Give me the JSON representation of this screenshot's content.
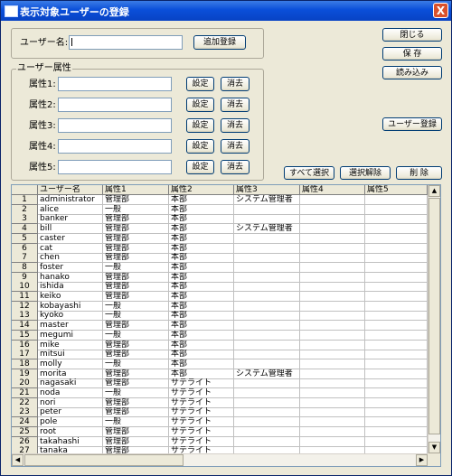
{
  "window": {
    "title": "表示対象ユーザーの登録",
    "close_label": "X"
  },
  "user_name": {
    "label": "ユーザー名:",
    "value": "",
    "add_button": "追加登録"
  },
  "attributes": {
    "group_label": "ユーザー属性",
    "items": [
      {
        "label": "属性1:",
        "value": "",
        "set": "設定",
        "clear": "消去"
      },
      {
        "label": "属性2:",
        "value": "",
        "set": "設定",
        "clear": "消去"
      },
      {
        "label": "属性3:",
        "value": "",
        "set": "設定",
        "clear": "消去"
      },
      {
        "label": "属性4:",
        "value": "",
        "set": "設定",
        "clear": "消去"
      },
      {
        "label": "属性5:",
        "value": "",
        "set": "設定",
        "clear": "消去"
      }
    ]
  },
  "side_buttons": {
    "close": "閉じる",
    "save": "保 存",
    "load": "読み込み",
    "register": "ユーザー登録"
  },
  "action_buttons": {
    "select_all": "すべて選択",
    "deselect": "選択解除",
    "delete": "削 除"
  },
  "table": {
    "columns": [
      "ユーザー名",
      "属性1",
      "属性2",
      "属性3",
      "属性4",
      "属性5"
    ],
    "rows": [
      [
        "1",
        "administrator",
        "管理部",
        "本部",
        "システム管理者",
        "",
        ""
      ],
      [
        "2",
        "alice",
        "一般",
        "本部",
        "",
        "",
        ""
      ],
      [
        "3",
        "banker",
        "管理部",
        "本部",
        "",
        "",
        ""
      ],
      [
        "4",
        "bill",
        "管理部",
        "本部",
        "システム管理者",
        "",
        ""
      ],
      [
        "5",
        "caster",
        "管理部",
        "本部",
        "",
        "",
        ""
      ],
      [
        "6",
        "cat",
        "管理部",
        "本部",
        "",
        "",
        ""
      ],
      [
        "7",
        "chen",
        "管理部",
        "本部",
        "",
        "",
        ""
      ],
      [
        "8",
        "foster",
        "一般",
        "本部",
        "",
        "",
        ""
      ],
      [
        "9",
        "hanako",
        "管理部",
        "本部",
        "",
        "",
        ""
      ],
      [
        "10",
        "ishida",
        "管理部",
        "本部",
        "",
        "",
        ""
      ],
      [
        "11",
        "keiko",
        "管理部",
        "本部",
        "",
        "",
        ""
      ],
      [
        "12",
        "kobayashi",
        "一般",
        "本部",
        "",
        "",
        ""
      ],
      [
        "13",
        "kyoko",
        "一般",
        "本部",
        "",
        "",
        ""
      ],
      [
        "14",
        "master",
        "管理部",
        "本部",
        "",
        "",
        ""
      ],
      [
        "15",
        "megumi",
        "一般",
        "本部",
        "",
        "",
        ""
      ],
      [
        "16",
        "mike",
        "管理部",
        "本部",
        "",
        "",
        ""
      ],
      [
        "17",
        "mitsui",
        "管理部",
        "本部",
        "",
        "",
        ""
      ],
      [
        "18",
        "molly",
        "一般",
        "本部",
        "",
        "",
        ""
      ],
      [
        "19",
        "morita",
        "管理部",
        "本部",
        "システム管理者",
        "",
        ""
      ],
      [
        "20",
        "nagasaki",
        "管理部",
        "サテライト",
        "",
        "",
        ""
      ],
      [
        "21",
        "noda",
        "一般",
        "サテライト",
        "",
        "",
        ""
      ],
      [
        "22",
        "nori",
        "管理部",
        "サテライト",
        "",
        "",
        ""
      ],
      [
        "23",
        "peter",
        "管理部",
        "サテライト",
        "",
        "",
        ""
      ],
      [
        "24",
        "pole",
        "一般",
        "サテライト",
        "",
        "",
        ""
      ],
      [
        "25",
        "root",
        "管理部",
        "サテライト",
        "",
        "",
        ""
      ],
      [
        "26",
        "takahashi",
        "管理部",
        "サテライト",
        "",
        "",
        ""
      ],
      [
        "27",
        "tanaka",
        "管理部",
        "サテライト",
        "",
        "",
        ""
      ]
    ]
  }
}
